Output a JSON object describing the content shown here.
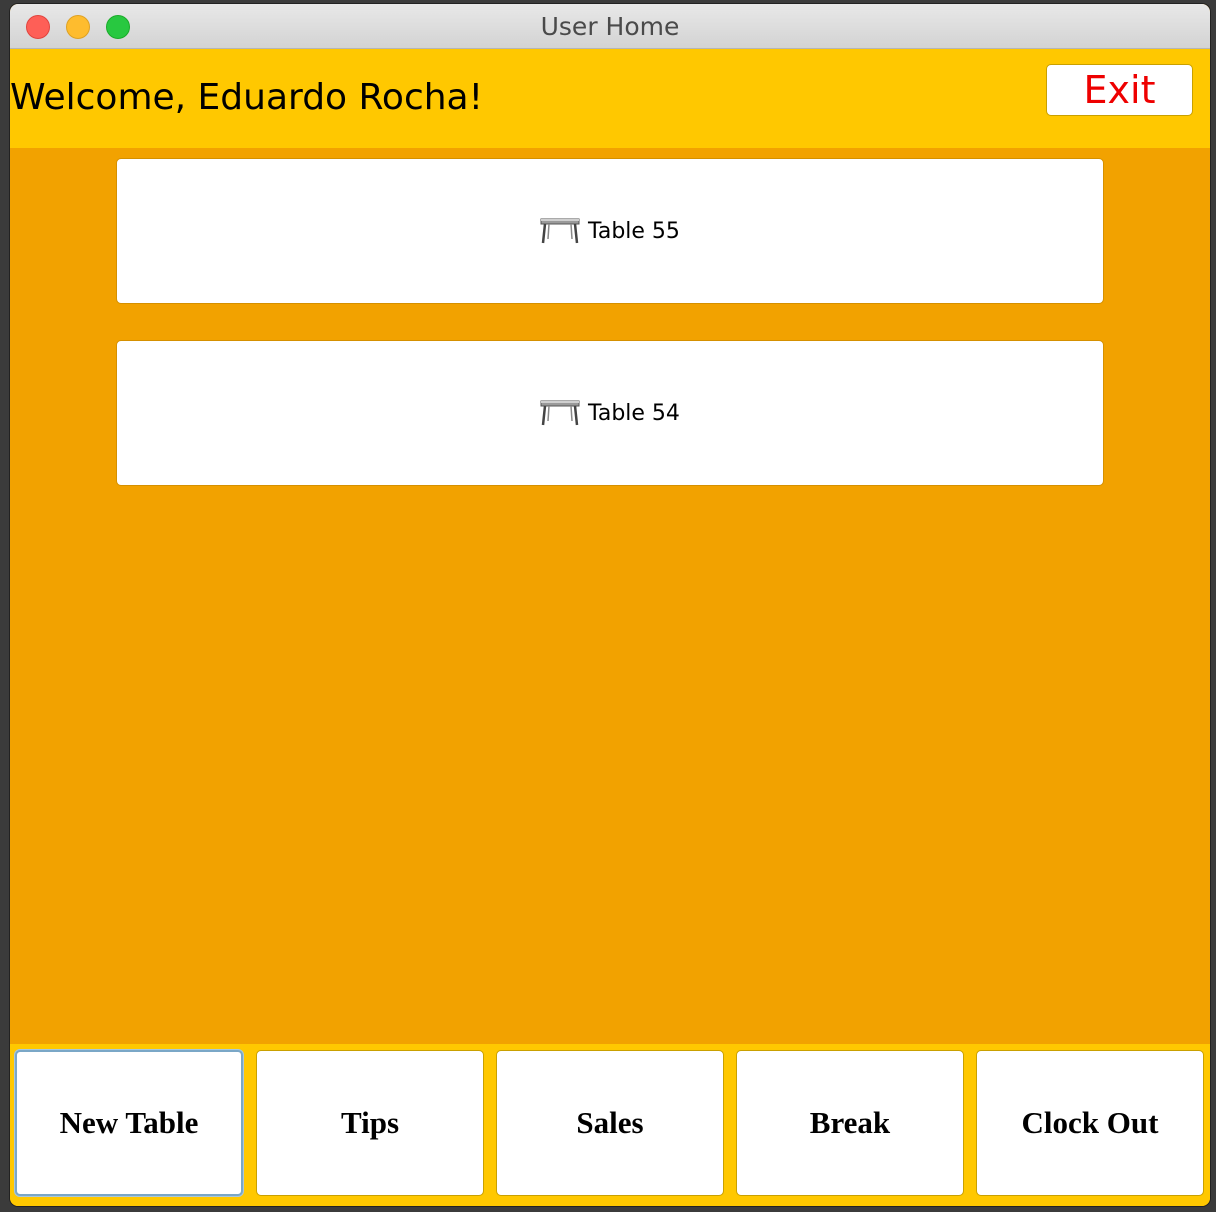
{
  "window": {
    "title": "User Home"
  },
  "header": {
    "welcome_text": "Welcome, Eduardo Rocha!",
    "exit_label": "Exit"
  },
  "tables": [
    {
      "label": "Table 55",
      "icon": "table-icon"
    },
    {
      "label": "Table 54",
      "icon": "table-icon"
    }
  ],
  "actions": [
    {
      "label": "New Table"
    },
    {
      "label": "Tips"
    },
    {
      "label": "Sales"
    },
    {
      "label": "Break"
    },
    {
      "label": "Clock Out"
    }
  ],
  "colors": {
    "header_bg": "#ffc800",
    "content_bg": "#f2a200",
    "exit_text": "#ee0000"
  }
}
